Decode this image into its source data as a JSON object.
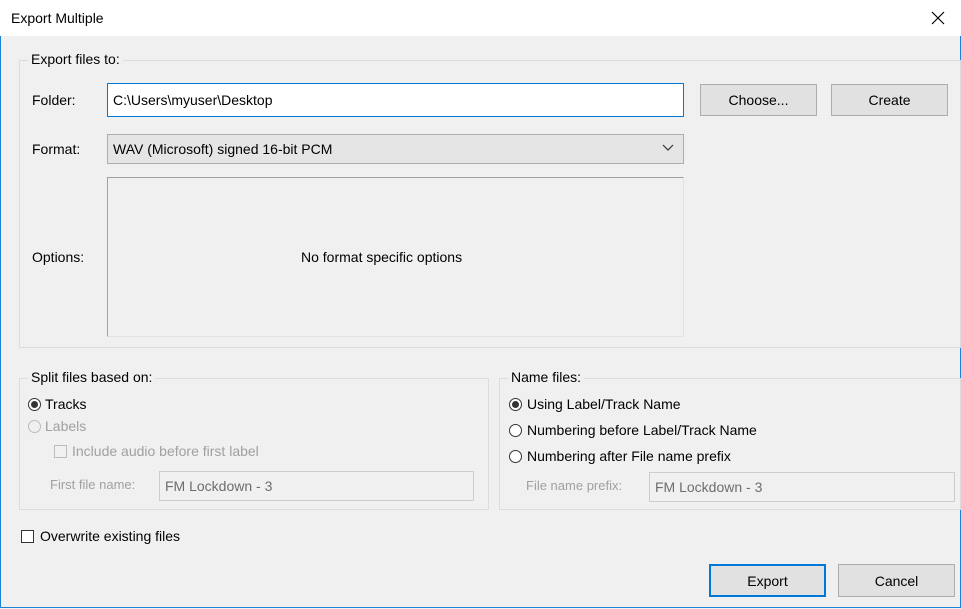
{
  "window": {
    "title": "Export Multiple"
  },
  "export_to": {
    "group_label": "Export files to:",
    "folder_label": "Folder:",
    "folder_value": "C:\\Users\\myuser\\Desktop",
    "choose_label": "Choose...",
    "create_label": "Create",
    "format_label": "Format:",
    "format_value": "WAV (Microsoft) signed 16-bit PCM",
    "options_label": "Options:",
    "options_text": "No format specific options"
  },
  "split": {
    "group_label": "Split files based on:",
    "tracks_label": "Tracks",
    "labels_label": "Labels",
    "include_audio_label": "Include audio before first label",
    "first_file_label": "First file name:",
    "first_file_value": "FM Lockdown - 3"
  },
  "name_files": {
    "group_label": "Name files:",
    "using_label": "Using Label/Track Name",
    "numbering_before_label": "Numbering before Label/Track Name",
    "numbering_after_label": "Numbering after File name prefix",
    "prefix_label": "File name prefix:",
    "prefix_value": "FM Lockdown - 3"
  },
  "overwrite_label": "Overwrite existing files",
  "buttons": {
    "export_label": "Export",
    "cancel_label": "Cancel"
  },
  "icons": {
    "close": "close-icon",
    "dropdown": "chevron-down-icon"
  }
}
